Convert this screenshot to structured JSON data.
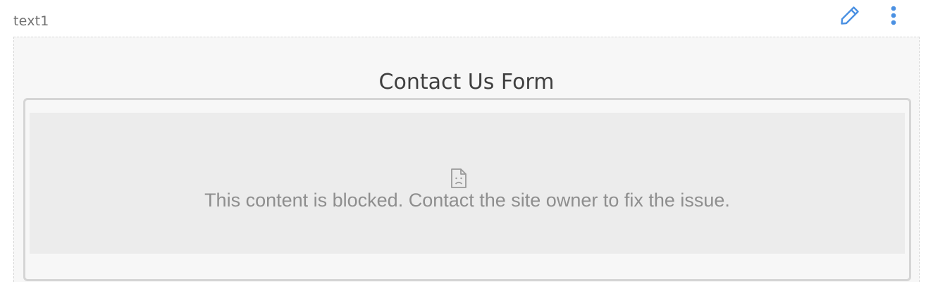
{
  "widget": {
    "label": "text1",
    "edit_icon": "pencil-icon",
    "more_icon": "kebab-menu-icon",
    "accent_color": "#4a90e2"
  },
  "form": {
    "title": "Contact Us Form"
  },
  "blocked": {
    "icon": "sad-document-icon",
    "message": "This content is blocked. Contact the site owner to fix the issue."
  }
}
